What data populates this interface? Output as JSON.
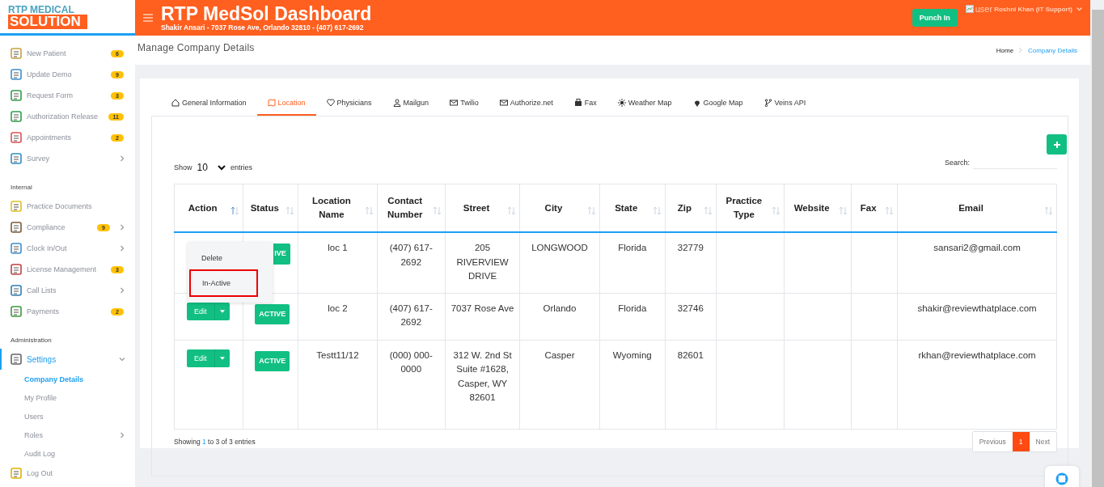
{
  "logo": {
    "line1": "RTP MEDICAL",
    "line2": "SOLUTION"
  },
  "header": {
    "title": "RTP MedSol Dashboard",
    "subtitle": "Shakir Ansari - 7037 Rose Ave, Orlando 32810 - (407) 617-2692",
    "punch_button": "Punch In",
    "user_image_alt": "user",
    "user_name": "Roshni Khan (IT Support)"
  },
  "sidebar": {
    "sections": [
      {
        "items": [
          {
            "label": "New Patient",
            "badge": "6",
            "has_submenu": false,
            "selected": false
          },
          {
            "label": "Update Demo",
            "badge": "9",
            "has_submenu": false,
            "selected": false
          },
          {
            "label": "Request Form",
            "badge": "3",
            "has_submenu": false,
            "selected": false
          },
          {
            "label": "Authorization Release",
            "badge": "11",
            "has_submenu": false,
            "selected": false
          },
          {
            "label": "Appointments",
            "badge": "2",
            "has_submenu": false,
            "selected": false
          },
          {
            "label": "Survey",
            "has_submenu": true,
            "selected": false
          }
        ]
      },
      {
        "heading": "Internal",
        "items": [
          {
            "label": "Practice Documents",
            "has_submenu": false,
            "selected": false
          },
          {
            "label": "Compliance",
            "badge": "9",
            "has_submenu": true,
            "selected": false
          },
          {
            "label": "Clock In/Out",
            "has_submenu": true,
            "selected": false
          },
          {
            "label": "License Management",
            "badge": "3",
            "has_submenu": false,
            "selected": false
          },
          {
            "label": "Call Lists",
            "has_submenu": true,
            "selected": false
          },
          {
            "label": "Payments",
            "badge": "2",
            "has_submenu": false,
            "selected": false
          }
        ]
      },
      {
        "heading": "Administration",
        "items": [
          {
            "label": "Settings",
            "has_submenu": true,
            "selected": true,
            "expanded": true,
            "children": [
              {
                "label": "Company Details",
                "selected": true,
                "has_submenu": false
              },
              {
                "label": "My Profile",
                "selected": false,
                "has_submenu": false
              },
              {
                "label": "Users",
                "selected": false,
                "has_submenu": false
              },
              {
                "label": "Roles",
                "selected": false,
                "has_submenu": true
              },
              {
                "label": "Audit Log",
                "selected": false,
                "has_submenu": false
              }
            ]
          },
          {
            "label": "Log Out",
            "has_submenu": false,
            "selected": false
          }
        ]
      }
    ]
  },
  "page_title": "Manage Company Details",
  "breadcrumb": [
    {
      "label": "Home",
      "selected": false
    },
    {
      "label": "Company Details",
      "selected": true
    }
  ],
  "tabs": [
    {
      "label": "General Information",
      "selected": false
    },
    {
      "label": "Location",
      "selected": true
    },
    {
      "label": "Physicians",
      "selected": false
    },
    {
      "label": "Mailgun",
      "selected": false
    },
    {
      "label": "Twilio",
      "selected": false
    },
    {
      "label": "Authorize.net",
      "selected": false
    },
    {
      "label": "Fax",
      "selected": false
    },
    {
      "label": "Weather Map",
      "selected": false
    },
    {
      "label": "Google Map",
      "selected": false
    },
    {
      "label": "Veins API",
      "selected": false
    }
  ],
  "table": {
    "show_label": "Show",
    "entries_value": "10",
    "entries_label": "entries",
    "search_label": "Search:",
    "columns": [
      {
        "label": "Action",
        "sorted": true
      },
      {
        "label": "Status",
        "sorted": false
      },
      {
        "label": "Location Name",
        "sorted": false
      },
      {
        "label": "Contact Number",
        "sorted": false
      },
      {
        "label": "Street",
        "sorted": false
      },
      {
        "label": "City",
        "sorted": false
      },
      {
        "label": "State",
        "sorted": false
      },
      {
        "label": "Zip",
        "sorted": false
      },
      {
        "label": "Practice Type",
        "sorted": false
      },
      {
        "label": "Website",
        "sorted": false
      },
      {
        "label": "Fax",
        "sorted": false
      },
      {
        "label": "Email",
        "sorted": false
      }
    ],
    "rows": [
      {
        "cells": [
          {
            "kind": "menu",
            "items": [
              {
                "label": "Delete",
                "highlighted": false
              },
              {
                "label": "In-Active",
                "highlighted": true
              }
            ]
          },
          {
            "kind": "badge",
            "label": "IVE"
          },
          "loc 1",
          "(407) 617-2692",
          "205 RIVERVIEW DRIVE",
          "LONGWOOD",
          "Florida",
          "32779",
          "",
          "",
          "",
          "sansari2@gmail.com"
        ]
      },
      {
        "cells": [
          {
            "kind": "split_button",
            "label": "Edit"
          },
          {
            "kind": "badge",
            "label": "ACTIVE"
          },
          "loc 2",
          "(407) 617-2692",
          "7037 Rose Ave",
          "Orlando",
          "Florida",
          "32746",
          "",
          "",
          "",
          "shakir@reviewthatplace.com"
        ]
      },
      {
        "cells": [
          {
            "kind": "split_button",
            "label": "Edit"
          },
          {
            "kind": "badge",
            "label": "ACTIVE"
          },
          "Testt11/12",
          "(000) 000-0000",
          "312 W. 2nd St Suite #1628, Casper, WY 82601",
          "Casper",
          "Wyoming",
          "82601",
          "",
          "",
          "",
          "rkhan@reviewthatplace.com"
        ]
      }
    ],
    "info": {
      "prefix": "Showing ",
      "from": "1",
      "middle": " to 3 of 3 entries"
    },
    "pagination": [
      {
        "label": "Previous",
        "selected": false
      },
      {
        "label": "1",
        "selected": true
      },
      {
        "label": "Next",
        "selected": false
      }
    ]
  }
}
